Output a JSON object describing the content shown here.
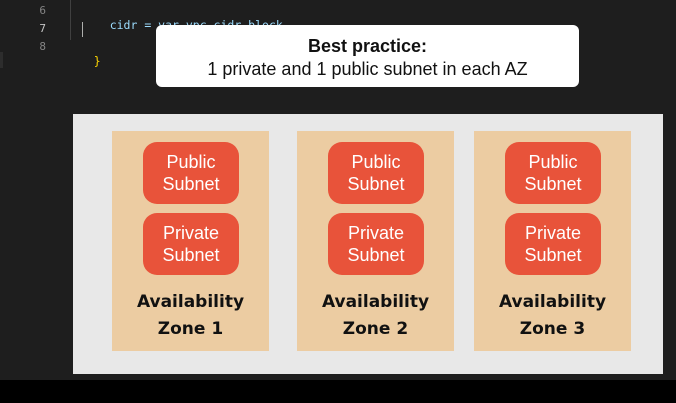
{
  "editor": {
    "lines": [
      {
        "num": "6",
        "code": "cidr = var.vpc_cidr_block"
      },
      {
        "num": "7",
        "code": ""
      },
      {
        "num": "8",
        "code": "}"
      }
    ]
  },
  "callout": {
    "title": "Best practice:",
    "subtitle": "1 private and 1 public subnet in each AZ"
  },
  "diagram": {
    "zones": [
      {
        "public": [
          "Public",
          "Subnet"
        ],
        "private": [
          "Private",
          "Subnet"
        ],
        "label": [
          "Availability",
          "Zone 1"
        ]
      },
      {
        "public": [
          "Public",
          "Subnet"
        ],
        "private": [
          "Private",
          "Subnet"
        ],
        "label": [
          "Availability",
          "Zone 2"
        ]
      },
      {
        "public": [
          "Public",
          "Subnet"
        ],
        "private": [
          "Private",
          "Subnet"
        ],
        "label": [
          "Availability",
          "Zone 3"
        ]
      }
    ],
    "colors": {
      "background": "#e8e8e8",
      "zone": "#eccca2",
      "subnet": "#e8533a"
    }
  }
}
